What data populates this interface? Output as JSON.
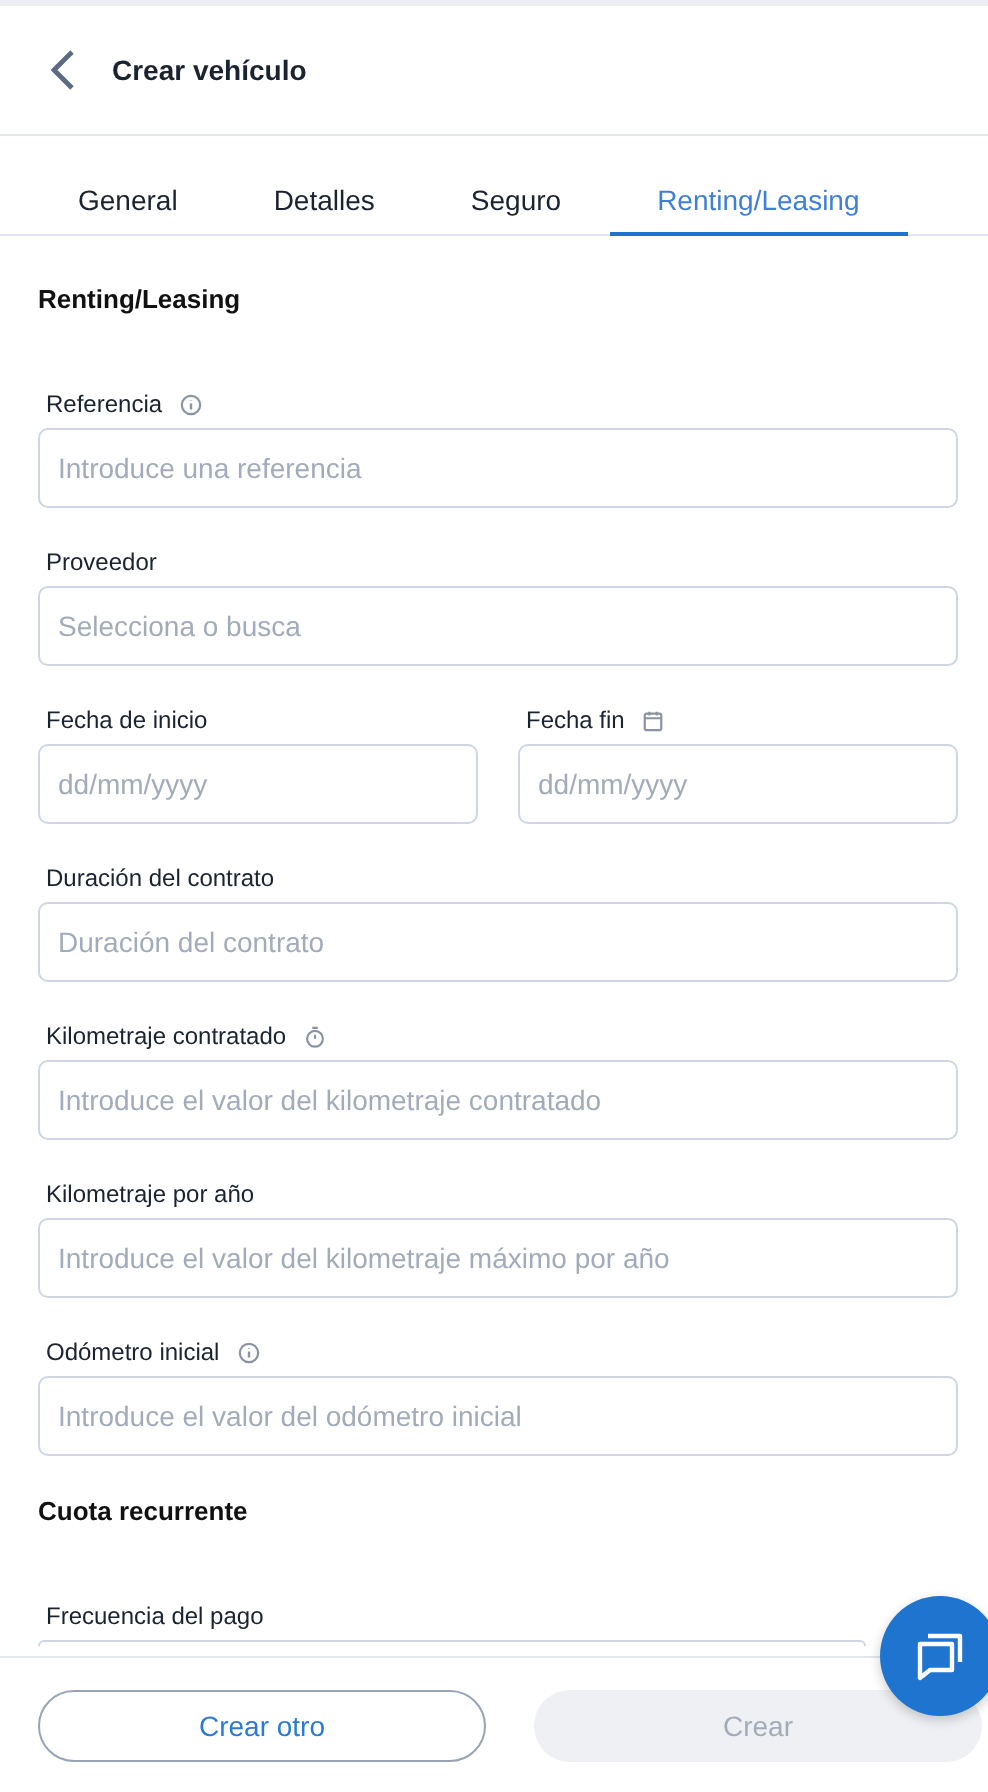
{
  "header": {
    "title": "Crear vehículo"
  },
  "tabs": [
    {
      "label": "General",
      "selected": false
    },
    {
      "label": "Detalles",
      "selected": false
    },
    {
      "label": "Seguro",
      "selected": false
    },
    {
      "label": "Renting/Leasing",
      "selected": true
    }
  ],
  "sections": [
    {
      "title": "Renting/Leasing",
      "rows": [
        [
          {
            "label": "Referencia",
            "kind": "info",
            "placeholder": "Introduce una referencia"
          }
        ],
        [
          {
            "label": "Proveedor",
            "placeholder": "Selecciona o busca"
          }
        ],
        [
          {
            "label": "Fecha de inicio",
            "placeholder": "dd/mm/yyyy"
          },
          {
            "label": "Fecha fin",
            "kind": "calendar",
            "placeholder": "dd/mm/yyyy"
          }
        ],
        [
          {
            "label": "Duración del contrato",
            "placeholder": "Duración del contrato"
          }
        ],
        [
          {
            "label": "Kilometraje contratado",
            "kind": "timer",
            "placeholder": "Introduce el valor del kilometraje contratado"
          }
        ],
        [
          {
            "label": "Kilometraje por año",
            "placeholder": "Introduce el valor del kilometraje máximo por año"
          }
        ],
        [
          {
            "label": "Odómetro inicial",
            "kind": "info",
            "placeholder": "Introduce el valor del odómetro inicial"
          }
        ]
      ]
    },
    {
      "title": "Cuota recurrente",
      "rows": [
        [
          {
            "label": "Frecuencia del pago"
          }
        ]
      ]
    }
  ],
  "footer": {
    "buttons": [
      {
        "label": "Crear otro",
        "kind": "outline",
        "disabled": false
      },
      {
        "label": "Crear",
        "kind": "primary",
        "disabled": true
      }
    ]
  }
}
